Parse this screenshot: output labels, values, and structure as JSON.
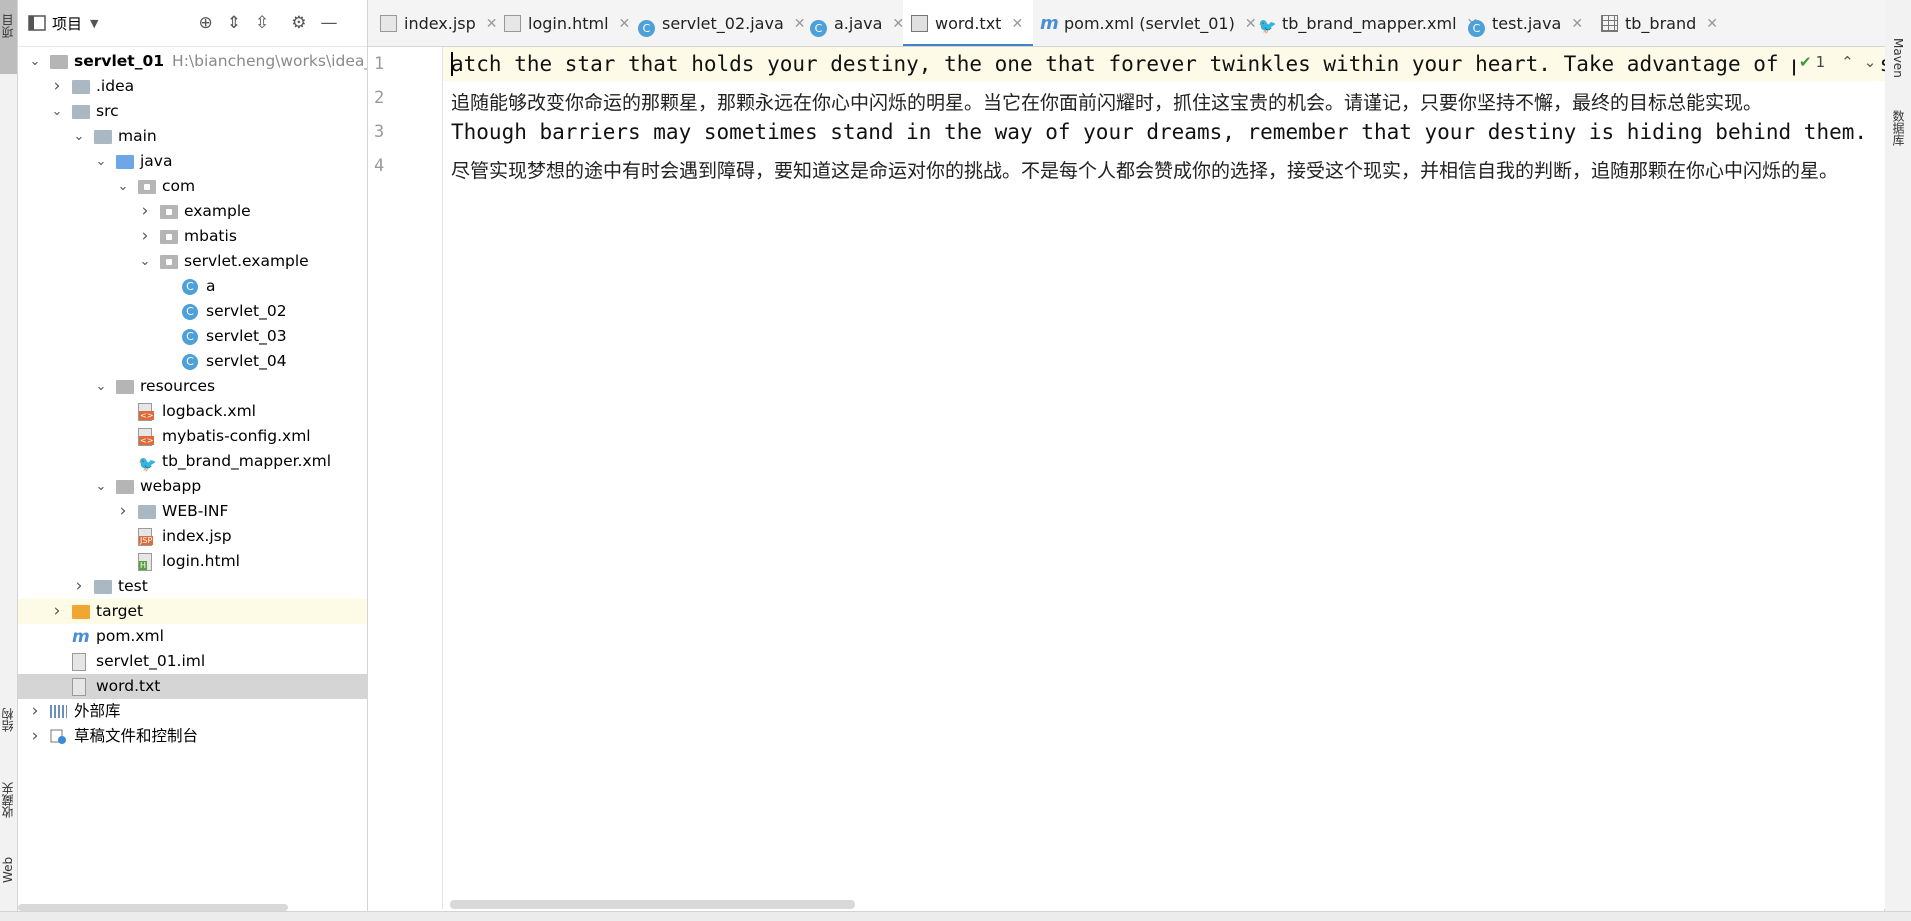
{
  "left_stripe": {
    "project_label": "项目",
    "structure_label": "结构",
    "favorites_label": "收藏夹",
    "web_label": "Web"
  },
  "right_stripe": {
    "maven_label": "Maven",
    "database_label": "数据库"
  },
  "project_panel": {
    "title": "项目",
    "tree": [
      {
        "label": "servlet_01",
        "path": "H:\\biancheng\\works\\idea_wo",
        "bold": true,
        "expanded": true,
        "depth": 0
      },
      {
        "label": ".idea",
        "depth": 1,
        "expanded": false
      },
      {
        "label": "src",
        "depth": 1,
        "expanded": true
      },
      {
        "label": "main",
        "depth": 2,
        "expanded": true
      },
      {
        "label": "java",
        "depth": 3,
        "expanded": true
      },
      {
        "label": "com",
        "depth": 4,
        "expanded": true
      },
      {
        "label": "example",
        "depth": 5,
        "expanded": false
      },
      {
        "label": "mbatis",
        "depth": 5,
        "expanded": false
      },
      {
        "label": "servlet.example",
        "depth": 5,
        "expanded": true
      },
      {
        "label": "a",
        "depth": 6
      },
      {
        "label": "servlet_02",
        "depth": 6
      },
      {
        "label": "servlet_03",
        "depth": 6
      },
      {
        "label": "servlet_04",
        "depth": 6
      },
      {
        "label": "resources",
        "depth": 3,
        "expanded": true
      },
      {
        "label": "logback.xml",
        "depth": 4
      },
      {
        "label": "mybatis-config.xml",
        "depth": 4
      },
      {
        "label": "tb_brand_mapper.xml",
        "depth": 4
      },
      {
        "label": "webapp",
        "depth": 3,
        "expanded": true
      },
      {
        "label": "WEB-INF",
        "depth": 4,
        "expanded": false
      },
      {
        "label": "index.jsp",
        "depth": 4
      },
      {
        "label": "login.html",
        "depth": 4
      },
      {
        "label": "test",
        "depth": 2,
        "expanded": false
      },
      {
        "label": "target",
        "depth": 1,
        "expanded": false
      },
      {
        "label": "pom.xml",
        "depth": 1
      },
      {
        "label": "servlet_01.iml",
        "depth": 1
      },
      {
        "label": "word.txt",
        "depth": 1,
        "selected": true
      },
      {
        "label": "外部库",
        "depth": 0,
        "expanded": false
      },
      {
        "label": "草稿文件和控制台",
        "depth": 0,
        "expanded": false
      }
    ]
  },
  "tabs": [
    {
      "label": "index.jsp",
      "icon": "jsp-file-icon"
    },
    {
      "label": "login.html",
      "icon": "html-file-icon"
    },
    {
      "label": "servlet_02.java",
      "icon": "java-class-icon"
    },
    {
      "label": "a.java",
      "icon": "java-class-icon"
    },
    {
      "label": "word.txt",
      "icon": "text-file-icon",
      "active": true
    },
    {
      "label": "pom.xml (servlet_01)",
      "icon": "maven-icon"
    },
    {
      "label": "tb_brand_mapper.xml",
      "icon": "mybatis-icon"
    },
    {
      "label": "test.java",
      "icon": "java-class-icon"
    },
    {
      "label": "tb_brand",
      "icon": "table-icon"
    }
  ],
  "editor": {
    "lines": [
      {
        "num": "1",
        "text": "atch the star that holds your destiny, the one that forever twinkles within your heart. Take advantage of precious opportunities while they still sparkle before you."
      },
      {
        "num": "2",
        "text": "追随能够改变你命运的那颗星，那颗永远在你心中闪烁的明星。当它在你面前闪耀时，抓住这宝贵的机会。请谨记，只要你坚持不懈，最终的目标总能实现。"
      },
      {
        "num": "3",
        "text": "Though barriers may sometimes stand in the way of your dreams, remember that your destiny is hiding behind them."
      },
      {
        "num": "4",
        "text": "尽管实现梦想的途中有时会遇到障碍，要知道这是命运对你的挑战。不是每个人都会赞成你的选择，接受这个现实，并相信自我的判断，追随那颗在你心中闪烁的星。"
      }
    ],
    "inspection_count": "1"
  }
}
